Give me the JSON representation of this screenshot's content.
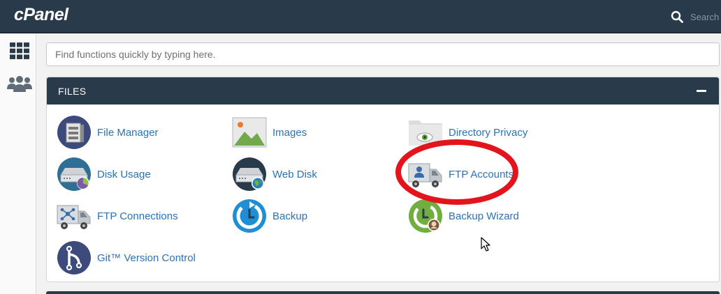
{
  "header": {
    "logo": "cPanel",
    "search_placeholder": "Search"
  },
  "sidebar": {
    "items": [
      {
        "icon": "grid-icon",
        "label": ""
      },
      {
        "icon": "users-icon",
        "label": ""
      }
    ]
  },
  "quick_search": {
    "placeholder": "Find functions quickly by typing here."
  },
  "files_panel": {
    "title": "FILES",
    "items": [
      {
        "label": "File Manager",
        "icon": "file-manager-icon"
      },
      {
        "label": "Images",
        "icon": "images-icon"
      },
      {
        "label": "Directory Privacy",
        "icon": "directory-privacy-icon"
      },
      {
        "label": "Disk Usage",
        "icon": "disk-usage-icon"
      },
      {
        "label": "Web Disk",
        "icon": "web-disk-icon"
      },
      {
        "label": "FTP Accounts",
        "icon": "ftp-accounts-icon"
      },
      {
        "label": "FTP Connections",
        "icon": "ftp-connections-icon"
      },
      {
        "label": "Backup",
        "icon": "backup-icon"
      },
      {
        "label": "Backup Wizard",
        "icon": "backup-wizard-icon"
      },
      {
        "label": "Git™ Version Control",
        "icon": "git-version-control-icon"
      }
    ]
  },
  "colors": {
    "header_bg": "#293a4a",
    "link": "#2a72b5",
    "highlight_ring": "#e3141b"
  }
}
